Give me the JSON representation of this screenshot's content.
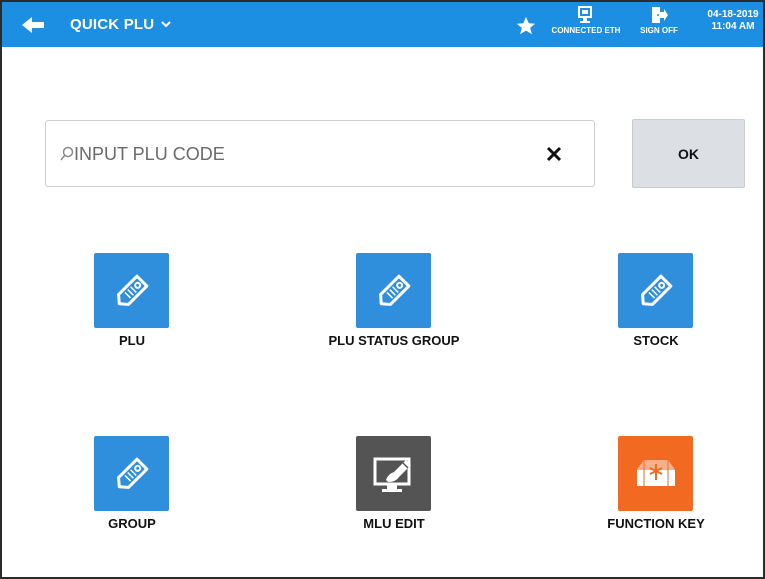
{
  "header": {
    "title": "QUICK PLU",
    "connection_status": "CONNECTED ETH",
    "sign_off_label": "SIGN OFF",
    "date": "04-18-2019",
    "time": "11:04 AM",
    "icons": [
      "back-arrow-icon",
      "chevron-down-icon",
      "star-icon",
      "network-icon",
      "sign-off-icon"
    ]
  },
  "search": {
    "placeholder": "INPUT PLU CODE",
    "value": "",
    "clear_icon": "close-icon"
  },
  "ok_button": {
    "label": "OK"
  },
  "tiles": [
    {
      "label": "PLU",
      "icon": "price-tag-icon",
      "color": "#2f8fdd"
    },
    {
      "label": "PLU STATUS GROUP",
      "icon": "price-tag-icon",
      "color": "#2f8fdd"
    },
    {
      "label": "STOCK",
      "icon": "price-tag-icon",
      "color": "#2f8fdd"
    },
    {
      "label": "GROUP",
      "icon": "price-tag-icon",
      "color": "#2f8fdd"
    },
    {
      "label": "MLU EDIT",
      "icon": "monitor-edit-icon",
      "color": "#545454"
    },
    {
      "label": "FUNCTION KEY",
      "icon": "function-key-icon",
      "color": "#f26a21"
    }
  ],
  "colors": {
    "header_bg": "#1d8fe3",
    "ok_bg": "#dcdfe3"
  }
}
